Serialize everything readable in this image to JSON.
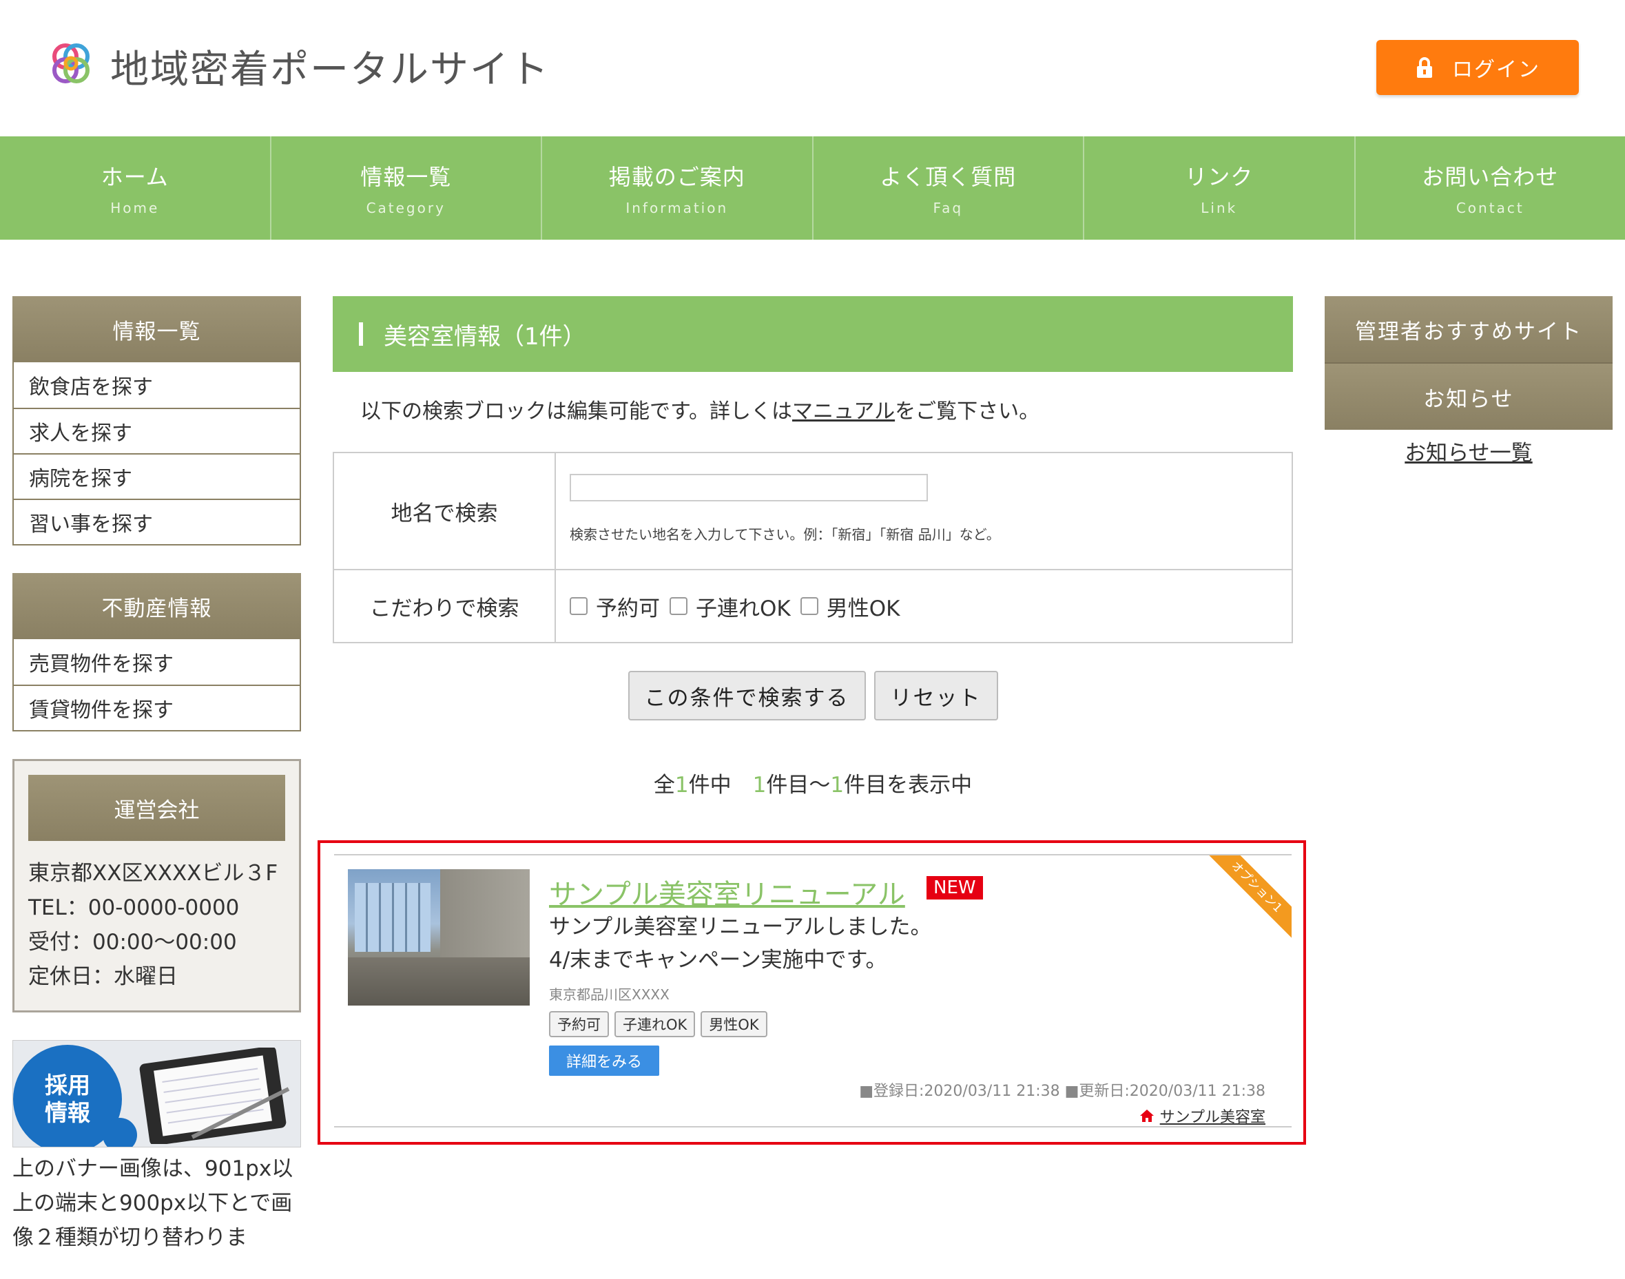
{
  "header": {
    "site_title": "地域密着ポータルサイト",
    "login_label": "ログイン",
    "colors": {
      "accent": "#ff7b0e",
      "nav": "#8ac367",
      "side": "#8a8063"
    }
  },
  "nav": [
    {
      "label": "ホーム",
      "sub": "Home"
    },
    {
      "label": "情報一覧",
      "sub": "Category"
    },
    {
      "label": "掲載のご案内",
      "sub": "Information"
    },
    {
      "label": "よく頂く質問",
      "sub": "Faq"
    },
    {
      "label": "リンク",
      "sub": "Link"
    },
    {
      "label": "お問い合わせ",
      "sub": "Contact"
    }
  ],
  "sidebar_left": {
    "info": {
      "title": "情報一覧",
      "items": [
        "飲食店を探す",
        "求人を探す",
        "病院を探す",
        "習い事を探す"
      ]
    },
    "realestate": {
      "title": "不動産情報",
      "items": [
        "売買物件を探す",
        "賃貸物件を探す"
      ]
    },
    "company": {
      "title": "運営会社",
      "lines": [
        "東京都XX区XXXXビル３F",
        "TEL：00-0000-0000",
        "受付：00:00〜00:00",
        "定休日：水曜日"
      ]
    },
    "banner": {
      "text_line1": "採用",
      "text_line2": "情報"
    },
    "banner_note": "上のバナー画像は、901px以上の端末と900px以下とで画像２種類が切り替わりま"
  },
  "main": {
    "heading": "美容室情報（1件）",
    "intro_before": "以下の検索ブロックは編集可能です。詳しくは",
    "intro_link": "マニュアル",
    "intro_after": "をご覧下さい。",
    "search": {
      "place_label": "地名で検索",
      "place_value": "",
      "place_hint": "検索させたい地名を入力して下さい。例：「新宿」「新宿 品川」など。",
      "feature_label": "こだわりで検索",
      "options": [
        "予約可",
        "子連れOK",
        "男性OK"
      ]
    },
    "search_button": "この条件で検索する",
    "reset_button": "リセット",
    "count": {
      "pre": "全",
      "total": "1",
      "mid1": "件中　",
      "from": "1",
      "mid2": "件目〜",
      "to": "1",
      "post": "件目を表示中"
    },
    "result": {
      "title": "サンプル美容室リニューアル",
      "badge": "NEW",
      "ribbon": "オプション1",
      "desc_line1": "サンプル美容室リニューアルしました。",
      "desc_line2": "4/末までキャンペーン実施中です。",
      "address": "東京都品川区XXXX",
      "tags": [
        "予約可",
        "子連れOK",
        "男性OK"
      ],
      "detail_button": "詳細をみる",
      "dates": "■登録日:2020/03/11 21:38 ■更新日:2020/03/11 21:38",
      "shop_link": "サンプル美容室"
    }
  },
  "sidebar_right": {
    "recommend_title": "管理者おすすめサイト",
    "news_title": "お知らせ",
    "news_link": "お知らせ一覧"
  }
}
